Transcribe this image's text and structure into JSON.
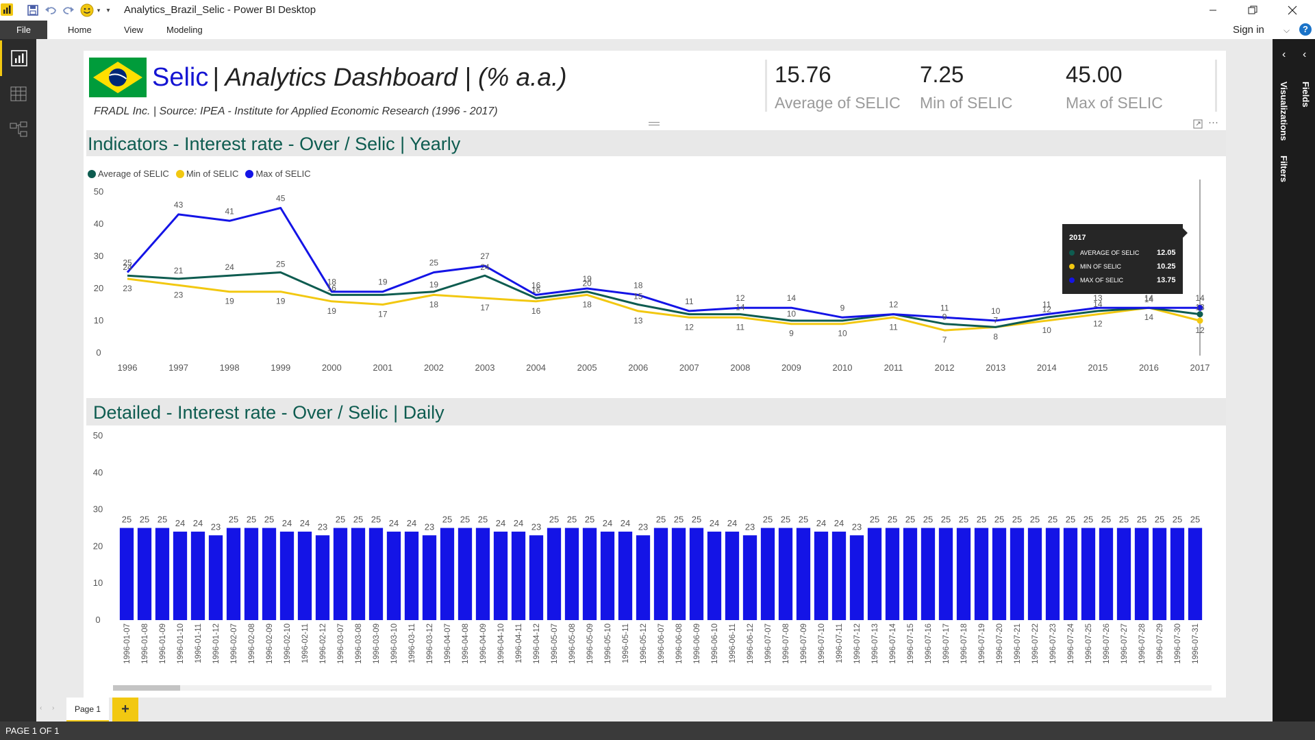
{
  "window": {
    "title": "Analytics_Brazil_Selic - Power BI Desktop",
    "sign_in": "Sign in"
  },
  "ribbon": {
    "file": "File",
    "tabs": [
      "Home",
      "View",
      "Modeling"
    ]
  },
  "right_panes": {
    "visualizations": "Visualizations",
    "fields": "Fields",
    "filters": "Filters"
  },
  "status": {
    "page_info": "PAGE 1 OF 1"
  },
  "page_tabs": {
    "page1": "Page 1",
    "add": "+"
  },
  "header": {
    "selic": "Selic",
    "dashboard": "| Analytics Dashboard | (% a.a.)",
    "source": "FRADL Inc. | Source: IPEA - Institute for Applied Economic Research (1996 - 2017)"
  },
  "kpis": [
    {
      "value": "15.76",
      "label": "Average of SELIC"
    },
    {
      "value": "7.25",
      "label": "Min of SELIC"
    },
    {
      "value": "45.00",
      "label": "Max of SELIC"
    }
  ],
  "colors": {
    "average": "#0e5c50",
    "min": "#f2c811",
    "max": "#1414e6",
    "title_text": "#0e5c50",
    "selic_text": "#1414d2"
  },
  "tooltip": {
    "title": "2017",
    "rows": [
      {
        "label": "AVERAGE OF SELIC",
        "value": "12.05"
      },
      {
        "label": "MIN OF SELIC",
        "value": "10.25"
      },
      {
        "label": "MAX OF SELIC",
        "value": "13.75"
      }
    ]
  },
  "chart_data": [
    {
      "type": "line",
      "title": "Indicators - Interest rate - Over / Selic | Yearly",
      "ylim": [
        0,
        50
      ],
      "yticks": [
        0,
        10,
        20,
        30,
        40,
        50
      ],
      "x": [
        "1996",
        "1997",
        "1998",
        "1999",
        "2000",
        "2001",
        "2002",
        "2003",
        "2004",
        "2005",
        "2006",
        "2007",
        "2008",
        "2009",
        "2010",
        "2011",
        "2012",
        "2013",
        "2014",
        "2015",
        "2016",
        "2017"
      ],
      "legend_position": "top-left",
      "grid": false,
      "series": [
        {
          "name": "Average of SELIC",
          "values": [
            24,
            23,
            24,
            25,
            18,
            18,
            19,
            24,
            17,
            19,
            15,
            12,
            12,
            10,
            10,
            12,
            9,
            8,
            11,
            13,
            14,
            12
          ]
        },
        {
          "name": "Min of SELIC",
          "values": [
            23,
            21,
            19,
            19,
            16,
            15,
            18,
            17,
            16,
            18,
            13,
            11,
            11,
            9,
            9,
            11,
            7,
            8,
            10,
            12,
            14,
            10
          ]
        },
        {
          "name": "Max of SELIC",
          "values": [
            25,
            43,
            41,
            45,
            19,
            19,
            25,
            27,
            18,
            20,
            18,
            13,
            14,
            14,
            11,
            12,
            11,
            10,
            12,
            14,
            14,
            14
          ]
        }
      ],
      "data_labels": {
        "average": [
          "24",
          "21",
          "24",
          "25",
          "",
          "",
          "",
          "24",
          "16",
          "20",
          "15",
          "",
          "",
          "",
          "",
          "",
          "",
          "",
          "12",
          "",
          "14",
          ""
        ],
        "min": [
          "23",
          "23",
          "19",
          "19",
          "19",
          "17",
          "18",
          "17",
          "16",
          "18",
          "13",
          "12",
          "11",
          "9",
          "10",
          "11",
          "7",
          "8",
          "10",
          "12",
          "14",
          "12"
        ],
        "max": [
          "25",
          "43",
          "41",
          "45",
          "18",
          "19",
          "25",
          "27",
          "16",
          "19",
          "18",
          "11",
          "12",
          "14",
          "9",
          "12",
          "11",
          "10",
          "11",
          "13",
          "14",
          "14"
        ],
        "extra": [
          "",
          "",
          "",
          "",
          "16",
          "",
          "19",
          "",
          "",
          "",
          "",
          "",
          "14",
          "10",
          "",
          "",
          "9",
          "7",
          "",
          "14",
          "",
          "13"
        ]
      }
    },
    {
      "type": "bar",
      "title": "Detailed - Interest rate - Over / Selic | Daily",
      "ylim": [
        0,
        50
      ],
      "yticks": [
        0,
        10,
        20,
        30,
        40,
        50
      ],
      "categories": [
        "1996-01-07",
        "1996-01-08",
        "1996-01-09",
        "1996-01-10",
        "1996-01-11",
        "1996-01-12",
        "1996-02-07",
        "1996-02-08",
        "1996-02-09",
        "1996-02-10",
        "1996-02-11",
        "1996-02-12",
        "1996-03-07",
        "1996-03-08",
        "1996-03-09",
        "1996-03-10",
        "1996-03-11",
        "1996-03-12",
        "1996-04-07",
        "1996-04-08",
        "1996-04-09",
        "1996-04-10",
        "1996-04-11",
        "1996-04-12",
        "1996-05-07",
        "1996-05-08",
        "1996-05-09",
        "1996-05-10",
        "1996-05-11",
        "1996-05-12",
        "1996-06-07",
        "1996-06-08",
        "1996-06-09",
        "1996-06-10",
        "1996-06-11",
        "1996-06-12",
        "1996-07-07",
        "1996-07-08",
        "1996-07-09",
        "1996-07-10",
        "1996-07-11",
        "1996-07-12",
        "1996-07-13",
        "1996-07-14",
        "1996-07-15",
        "1996-07-16",
        "1996-07-17",
        "1996-07-18",
        "1996-07-19",
        "1996-07-20",
        "1996-07-21",
        "1996-07-22",
        "1996-07-23",
        "1996-07-24",
        "1996-07-25",
        "1996-07-26",
        "1996-07-27",
        "1996-07-28",
        "1996-07-29",
        "1996-07-30",
        "1996-07-31"
      ],
      "values": [
        25,
        25,
        25,
        24,
        24,
        23,
        25,
        25,
        25,
        24,
        24,
        23,
        25,
        25,
        25,
        24,
        24,
        23,
        25,
        25,
        25,
        24,
        24,
        23,
        25,
        25,
        25,
        24,
        24,
        23,
        25,
        25,
        25,
        24,
        24,
        23,
        25,
        25,
        25,
        24,
        24,
        23,
        25,
        25,
        25,
        25,
        25,
        25,
        25,
        25,
        25,
        25,
        25,
        25,
        25,
        25,
        25,
        25,
        25,
        25,
        25
      ]
    }
  ]
}
